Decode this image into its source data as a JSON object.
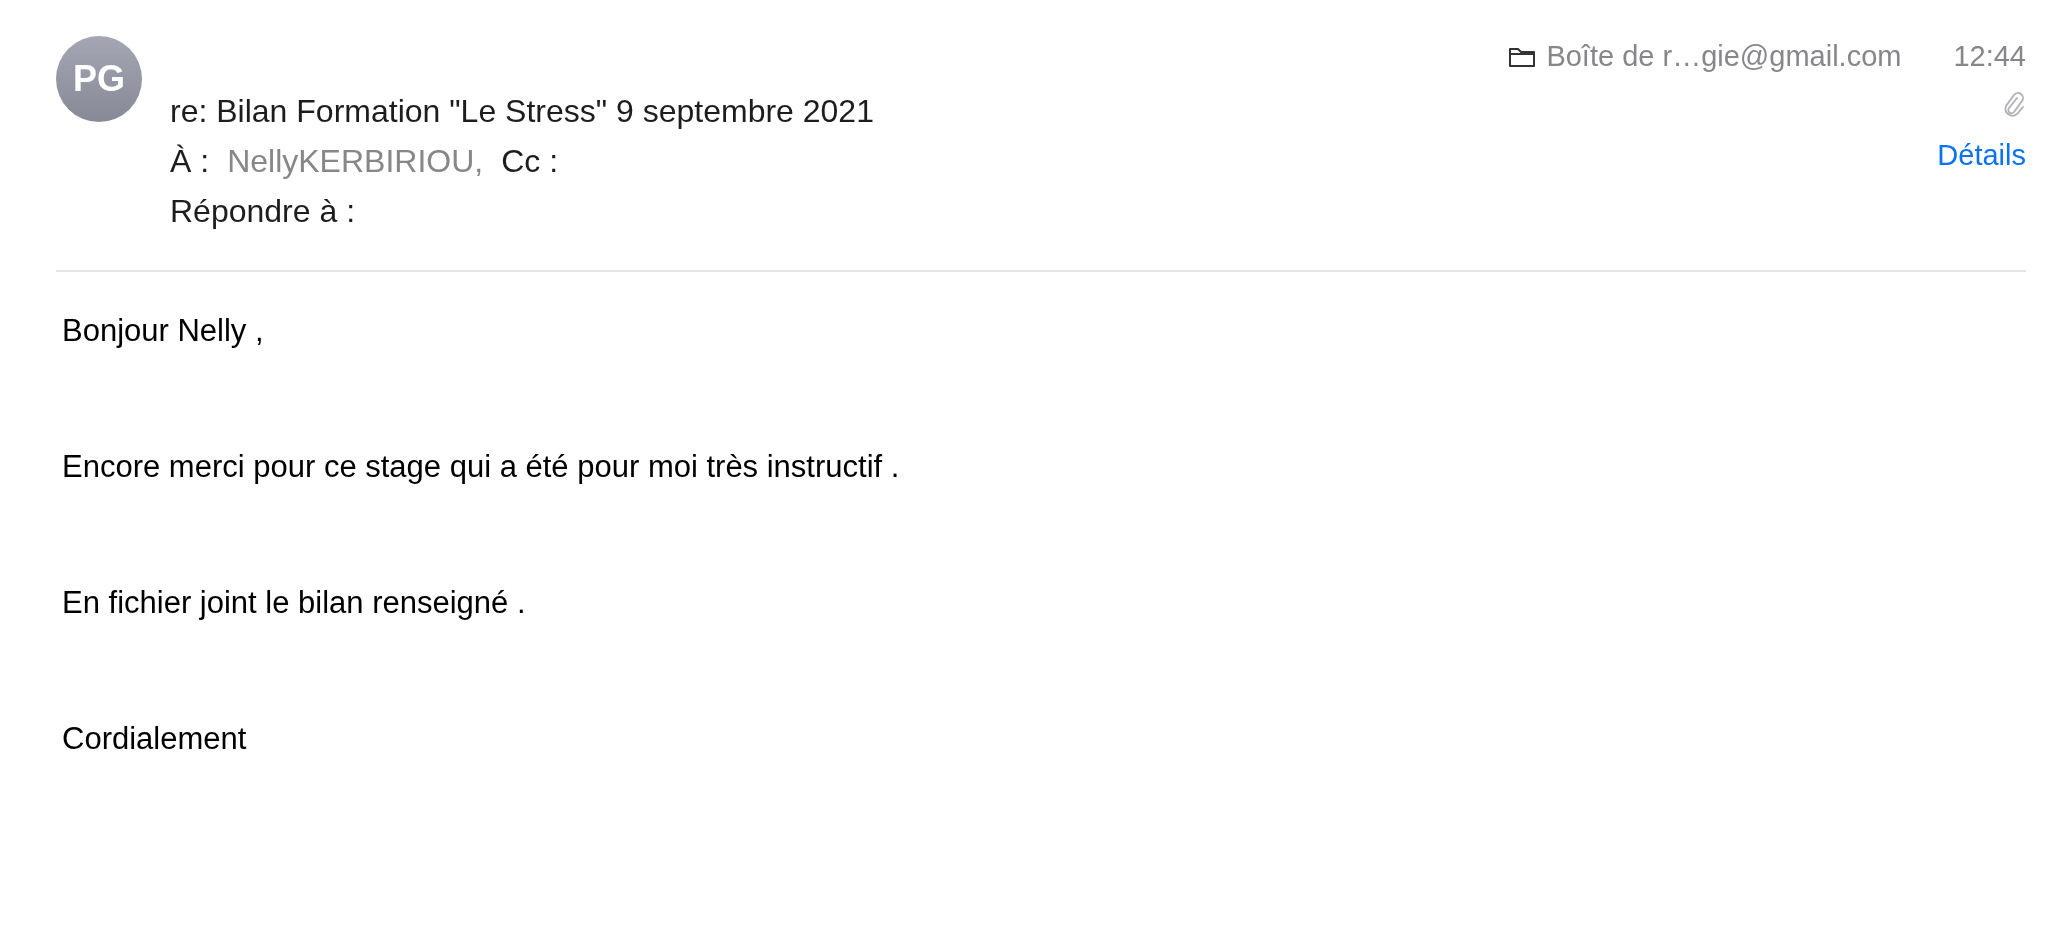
{
  "sender": {
    "initials": "PG"
  },
  "subject": "re: Bilan Formation \"Le Stress\" 9 septembre 2021",
  "mailbox": "Boîte de r…gie@gmail.com",
  "time": "12:44",
  "has_attachment": true,
  "to": {
    "label": "À :",
    "recipients": [
      "NellyKERBIRIOU,"
    ]
  },
  "cc": {
    "label": "Cc :"
  },
  "reply_to": {
    "label": "Répondre à :"
  },
  "details_link": "Détails",
  "body": [
    "Bonjour Nelly ,",
    "Encore merci pour ce stage qui a été pour moi très instructif .",
    "En fichier joint le bilan renseigné .",
    "Cordialement"
  ]
}
